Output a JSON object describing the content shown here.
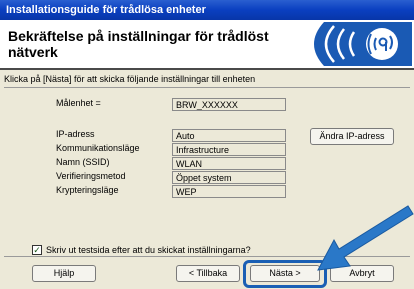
{
  "window": {
    "title": "Installationsguide för trådlösa enheter"
  },
  "header": {
    "title": "Bekräftelse på inställningar för trådlöst nätverk",
    "logo_icon": "wireless-signal-icon"
  },
  "instruction": "Klicka på [Nästa] för att skicka följande inställningar till enheten",
  "target": {
    "label": "Målenhet =",
    "value": "BRW_XXXXXX"
  },
  "settings": [
    {
      "label": "IP-adress",
      "value": "Auto"
    },
    {
      "label": "Kommunikationsläge",
      "value": "Infrastructure"
    },
    {
      "label": "Namn (SSID)",
      "value": "WLAN"
    },
    {
      "label": "Verifieringsmetod",
      "value": "Öppet system"
    },
    {
      "label": "Krypteringsläge",
      "value": "WEP"
    }
  ],
  "change_ip_label": "Ändra IP-adress",
  "print_test": {
    "checked": true,
    "label": "Skriv ut testsida efter att du skickat inställningarna?"
  },
  "buttons": {
    "help": "Hjälp",
    "back": "< Tillbaka",
    "next": "Nästa >",
    "cancel": "Avbryt"
  },
  "colors": {
    "titlebar": "#0a3fc0",
    "dialog_bg": "#ece9d8",
    "highlight": "#1a5fb4",
    "arrow": "#2a78c8"
  }
}
